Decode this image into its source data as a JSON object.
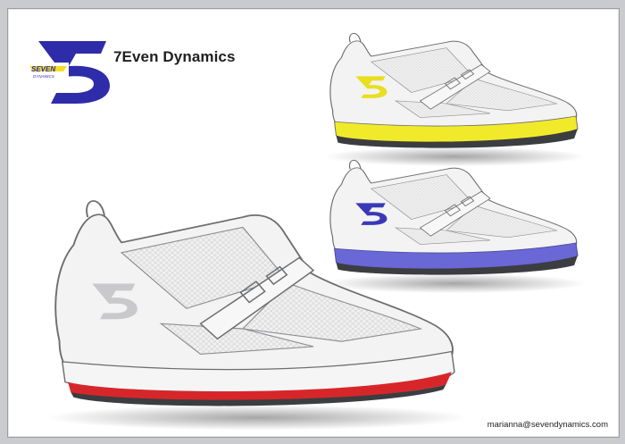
{
  "brand": {
    "name": "7Even Dynamics",
    "logo_text": "SEVEN",
    "logo_subtext": "DYNAMICS"
  },
  "footer": {
    "email": "marianna@sevendynamics.com"
  },
  "shoes": [
    {
      "name": "shoe-yellow",
      "sole_color": "#f1ea2a"
    },
    {
      "name": "shoe-blue",
      "sole_color": "#6a67d6"
    },
    {
      "name": "shoe-red",
      "sole_color": "#d7262a"
    }
  ],
  "colors": {
    "logo_blue": "#2e2ca8",
    "logo_yellow": "#f3de26",
    "outline": "#6b6d70",
    "upper": "#f3f3f3",
    "mesh": "#e9e9e9"
  }
}
